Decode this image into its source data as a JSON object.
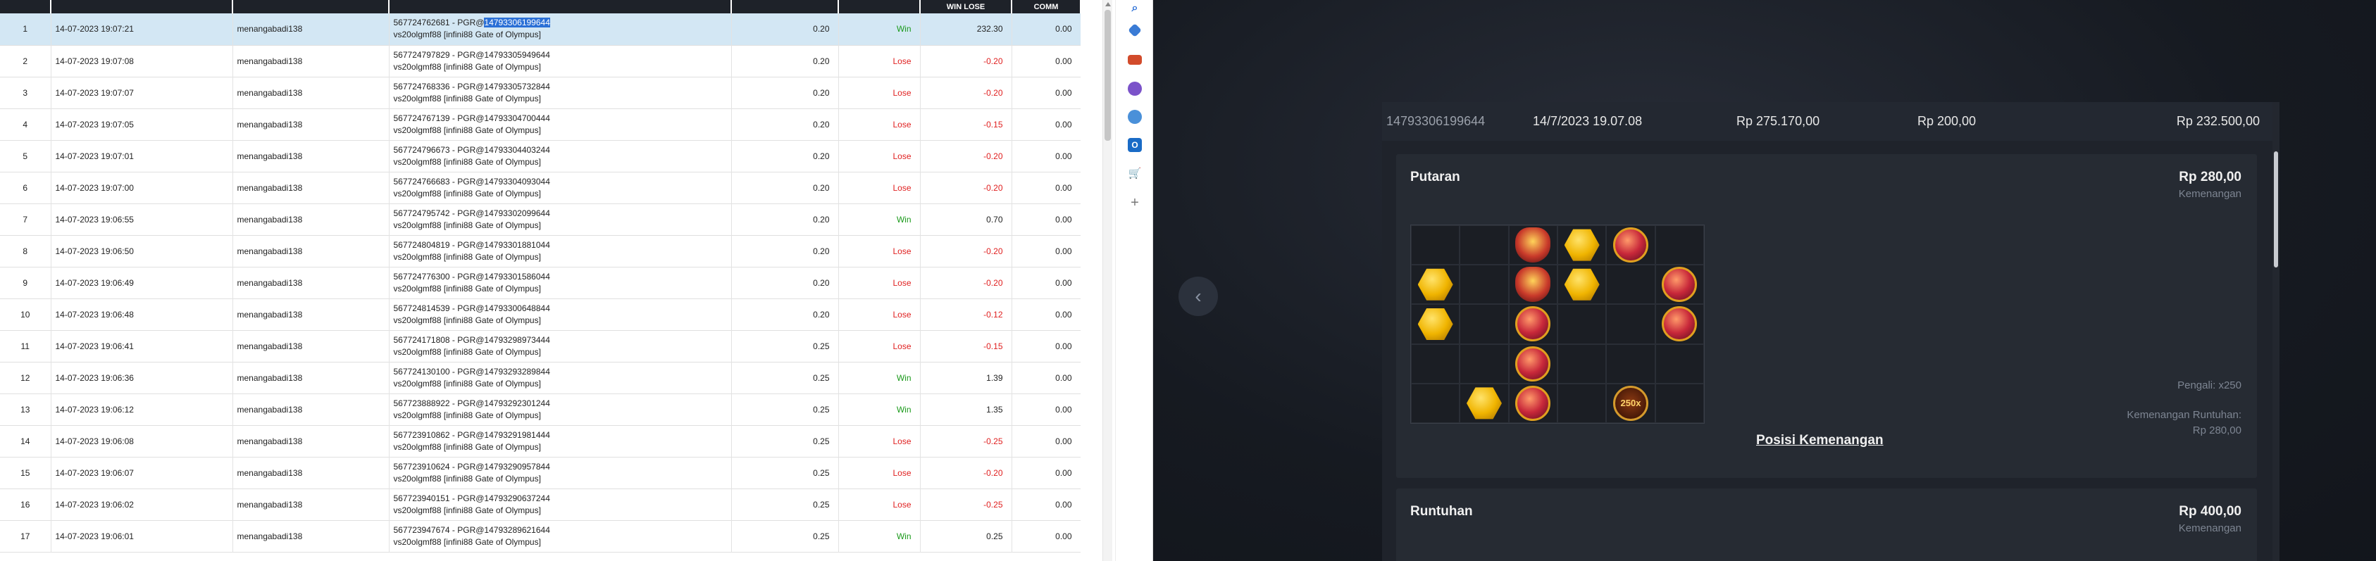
{
  "table": {
    "headers": [
      "",
      "",
      "",
      "",
      "",
      "",
      "WIN LOSE",
      "COMM"
    ],
    "rows": [
      {
        "no": "1",
        "date": "14-07-2023 19:07:21",
        "user": "menangabadi138",
        "tx_prefix": "567724762681 - PGR@",
        "tx_hl": "14793306199644",
        "tx_game": "vs20olgmf88 [infini88 Gate of Olympus]",
        "bet": "0.20",
        "result": "Win",
        "winlose": "232.30",
        "comm": "0.00",
        "selected": true
      },
      {
        "no": "2",
        "date": "14-07-2023 19:07:08",
        "user": "menangabadi138",
        "tx_prefix": "567724797829 - PGR@14793305949644",
        "tx_hl": "",
        "tx_game": "vs20olgmf88 [infini88 Gate of Olympus]",
        "bet": "0.20",
        "result": "Lose",
        "winlose": "-0.20",
        "comm": "0.00"
      },
      {
        "no": "3",
        "date": "14-07-2023 19:07:07",
        "user": "menangabadi138",
        "tx_prefix": "567724768336 - PGR@14793305732844",
        "tx_hl": "",
        "tx_game": "vs20olgmf88 [infini88 Gate of Olympus]",
        "bet": "0.20",
        "result": "Lose",
        "winlose": "-0.20",
        "comm": "0.00"
      },
      {
        "no": "4",
        "date": "14-07-2023 19:07:05",
        "user": "menangabadi138",
        "tx_prefix": "567724767139 - PGR@14793304700444",
        "tx_hl": "",
        "tx_game": "vs20olgmf88 [infini88 Gate of Olympus]",
        "bet": "0.20",
        "result": "Lose",
        "winlose": "-0.15",
        "comm": "0.00"
      },
      {
        "no": "5",
        "date": "14-07-2023 19:07:01",
        "user": "menangabadi138",
        "tx_prefix": "567724796673 - PGR@14793304403244",
        "tx_hl": "",
        "tx_game": "vs20olgmf88 [infini88 Gate of Olympus]",
        "bet": "0.20",
        "result": "Lose",
        "winlose": "-0.20",
        "comm": "0.00"
      },
      {
        "no": "6",
        "date": "14-07-2023 19:07:00",
        "user": "menangabadi138",
        "tx_prefix": "567724766683 - PGR@14793304093044",
        "tx_hl": "",
        "tx_game": "vs20olgmf88 [infini88 Gate of Olympus]",
        "bet": "0.20",
        "result": "Lose",
        "winlose": "-0.20",
        "comm": "0.00"
      },
      {
        "no": "7",
        "date": "14-07-2023 19:06:55",
        "user": "menangabadi138",
        "tx_prefix": "567724795742 - PGR@14793302099644",
        "tx_hl": "",
        "tx_game": "vs20olgmf88 [infini88 Gate of Olympus]",
        "bet": "0.20",
        "result": "Win",
        "winlose": "0.70",
        "comm": "0.00"
      },
      {
        "no": "8",
        "date": "14-07-2023 19:06:50",
        "user": "menangabadi138",
        "tx_prefix": "567724804819 - PGR@14793301881044",
        "tx_hl": "",
        "tx_game": "vs20olgmf88 [infini88 Gate of Olympus]",
        "bet": "0.20",
        "result": "Lose",
        "winlose": "-0.20",
        "comm": "0.00"
      },
      {
        "no": "9",
        "date": "14-07-2023 19:06:49",
        "user": "menangabadi138",
        "tx_prefix": "567724776300 - PGR@14793301586044",
        "tx_hl": "",
        "tx_game": "vs20olgmf88 [infini88 Gate of Olympus]",
        "bet": "0.20",
        "result": "Lose",
        "winlose": "-0.20",
        "comm": "0.00"
      },
      {
        "no": "10",
        "date": "14-07-2023 19:06:48",
        "user": "menangabadi138",
        "tx_prefix": "567724814539 - PGR@14793300648844",
        "tx_hl": "",
        "tx_game": "vs20olgmf88 [infini88 Gate of Olympus]",
        "bet": "0.20",
        "result": "Lose",
        "winlose": "-0.12",
        "comm": "0.00"
      },
      {
        "no": "11",
        "date": "14-07-2023 19:06:41",
        "user": "menangabadi138",
        "tx_prefix": "567724171808 - PGR@14793298973444",
        "tx_hl": "",
        "tx_game": "vs20olgmf88 [infini88 Gate of Olympus]",
        "bet": "0.25",
        "result": "Lose",
        "winlose": "-0.15",
        "comm": "0.00"
      },
      {
        "no": "12",
        "date": "14-07-2023 19:06:36",
        "user": "menangabadi138",
        "tx_prefix": "567724130100 - PGR@14793293289844",
        "tx_hl": "",
        "tx_game": "vs20olgmf88 [infini88 Gate of Olympus]",
        "bet": "0.25",
        "result": "Win",
        "winlose": "1.39",
        "comm": "0.00"
      },
      {
        "no": "13",
        "date": "14-07-2023 19:06:12",
        "user": "menangabadi138",
        "tx_prefix": "567723888922 - PGR@14793292301244",
        "tx_hl": "",
        "tx_game": "vs20olgmf88 [infini88 Gate of Olympus]",
        "bet": "0.25",
        "result": "Win",
        "winlose": "1.35",
        "comm": "0.00"
      },
      {
        "no": "14",
        "date": "14-07-2023 19:06:08",
        "user": "menangabadi138",
        "tx_prefix": "567723910862 - PGR@14793291981444",
        "tx_hl": "",
        "tx_game": "vs20olgmf88 [infini88 Gate of Olympus]",
        "bet": "0.25",
        "result": "Lose",
        "winlose": "-0.25",
        "comm": "0.00"
      },
      {
        "no": "15",
        "date": "14-07-2023 19:06:07",
        "user": "menangabadi138",
        "tx_prefix": "567723910624 - PGR@14793290957844",
        "tx_hl": "",
        "tx_game": "vs20olgmf88 [infini88 Gate of Olympus]",
        "bet": "0.25",
        "result": "Lose",
        "winlose": "-0.20",
        "comm": "0.00"
      },
      {
        "no": "16",
        "date": "14-07-2023 19:06:02",
        "user": "menangabadi138",
        "tx_prefix": "567723940151 - PGR@14793290637244",
        "tx_hl": "",
        "tx_game": "vs20olgmf88 [infini88 Gate of Olympus]",
        "bet": "0.25",
        "result": "Lose",
        "winlose": "-0.25",
        "comm": "0.00"
      },
      {
        "no": "17",
        "date": "14-07-2023 19:06:01",
        "user": "menangabadi138",
        "tx_prefix": "567723947674 - PGR@14793289621644",
        "tx_hl": "",
        "tx_game": "vs20olgmf88 [infini88 Gate of Olympus]",
        "bet": "0.25",
        "result": "Win",
        "winlose": "0.25",
        "comm": "0.00"
      }
    ]
  },
  "extensions": {
    "icons": [
      "search-icon",
      "tag-icon",
      "toolbox-icon",
      "people-icon",
      "gear-icon",
      "outlook-icon",
      "cart-icon",
      "plus-icon"
    ],
    "colors": [
      "#2b6fd6",
      "#3a7bd5",
      "#d24b2b",
      "#7b52c9",
      "#4a90d9",
      "#1a6bc6",
      "#3a8fd9",
      "#777777"
    ]
  },
  "detail": {
    "summary": {
      "round_id": "14793306199644",
      "datetime": "14/7/2023 19.07.08",
      "balance": "Rp 275.170,00",
      "bet": "Rp 200,00",
      "win": "Rp 232.500,00"
    },
    "putaran": {
      "title": "Putaran",
      "amount": "Rp 280,00",
      "amount_label": "Kemenangan",
      "multiplier_label": "Pengali: x250",
      "cascade_label": "Kemenangan Runtuhan:",
      "cascade_amount": "Rp 280,00",
      "link": "Posisi Kemenangan",
      "grid": [
        [
          "",
          "",
          "crown",
          "gold",
          "red",
          ""
        ],
        [
          "gold",
          "",
          "crown",
          "gold",
          "",
          "red"
        ],
        [
          "gold",
          "",
          "red",
          "",
          "",
          "red"
        ],
        [
          "",
          "",
          "red",
          "",
          "",
          ""
        ],
        [
          "",
          "gold",
          "red",
          "",
          "mult",
          ""
        ]
      ],
      "multiplier_text": "250x"
    },
    "runtuhan": {
      "title": "Runtuhan",
      "amount": "Rp 400,00",
      "amount_label": "Kemenangan"
    }
  }
}
